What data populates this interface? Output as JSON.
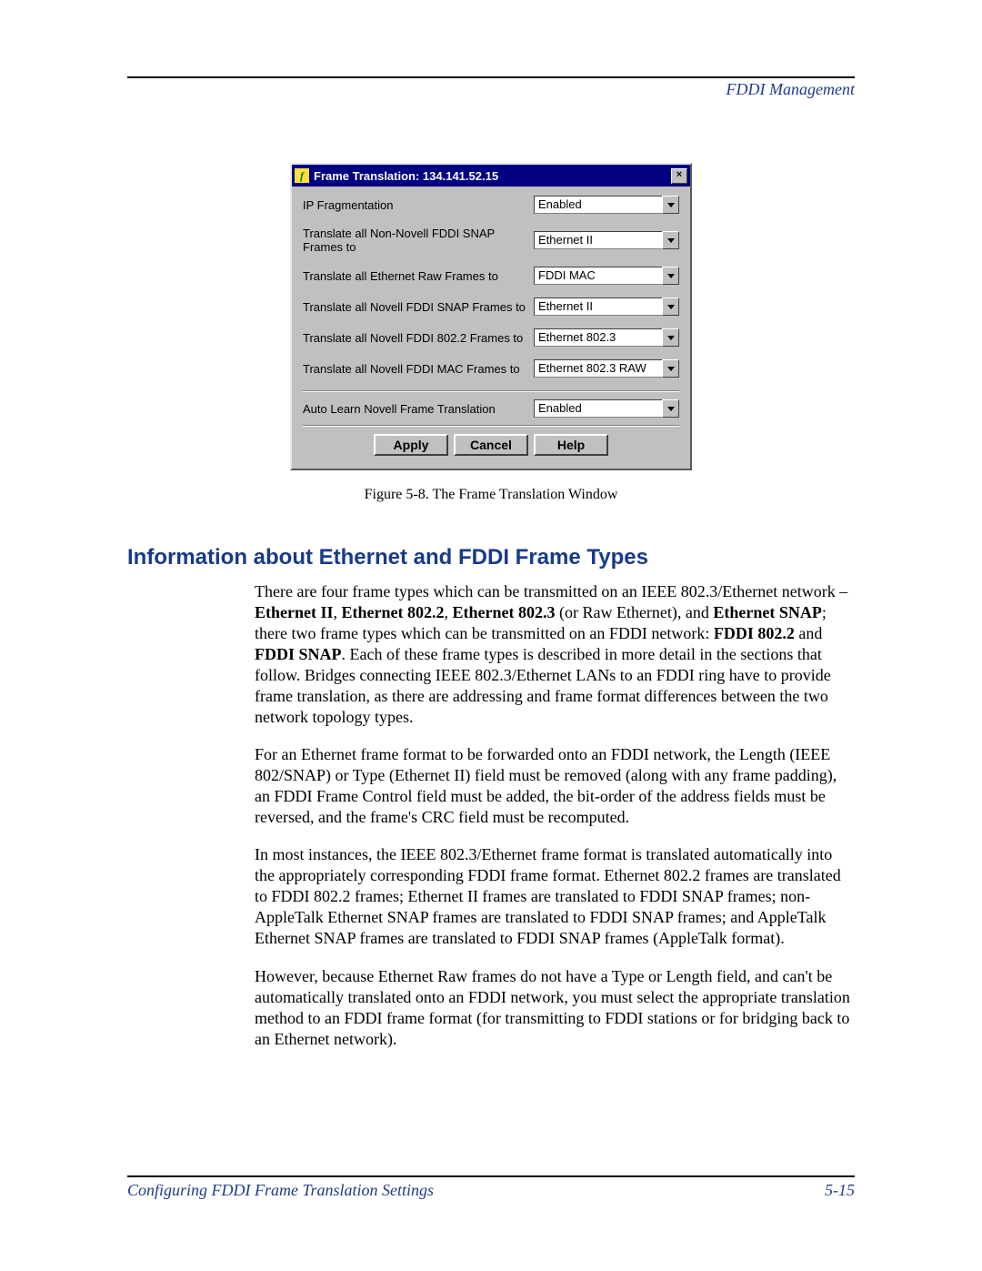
{
  "header": {
    "section_title": "FDDI Management"
  },
  "dialog": {
    "title": "Frame Translation: 134.141.52.15",
    "close_glyph": "×",
    "rows": [
      {
        "label": "IP Fragmentation",
        "value": "Enabled"
      },
      {
        "label": "Translate all Non-Novell FDDI SNAP Frames to",
        "value": "Ethernet II"
      },
      {
        "label": "Translate all Ethernet Raw Frames to",
        "value": "FDDI MAC"
      },
      {
        "label": "Translate all Novell FDDI SNAP Frames to",
        "value": "Ethernet II"
      },
      {
        "label": "Translate all Novell FDDI 802.2 Frames to",
        "value": "Ethernet 802.3"
      },
      {
        "label": "Translate all Novell FDDI MAC Frames to",
        "value": "Ethernet 802.3 RAW"
      },
      {
        "label": "Auto Learn Novell Frame Translation",
        "value": "Enabled"
      }
    ],
    "buttons": {
      "apply": "Apply",
      "cancel": "Cancel",
      "help": "Help"
    }
  },
  "figure_caption": "Figure 5-8. The Frame Translation Window",
  "heading": "Information about Ethernet and FDDI Frame Types",
  "paragraphs": {
    "p1_a": "There are four frame types which can be transmitted on an IEEE 802.3/Ethernet network – ",
    "p1_b1": "Ethernet II",
    "p1_c": ", ",
    "p1_b2": "Ethernet 802.2",
    "p1_d": ", ",
    "p1_b3": "Ethernet 802.3",
    "p1_e": " (or Raw Ethernet), and ",
    "p1_b4": "Ethernet SNAP",
    "p1_f": "; there two frame types which can be transmitted on an FDDI network: ",
    "p1_b5": "FDDI 802.2",
    "p1_g": " and ",
    "p1_b6": "FDDI SNAP",
    "p1_h": ". Each of these frame types is described in more detail in the sections that follow. Bridges connecting IEEE 802.3/Ethernet LANs to an FDDI ring have to provide frame translation, as there are addressing and frame format differences between the two network topology types.",
    "p2": "For an Ethernet frame format to be forwarded onto an FDDI network, the Length (IEEE 802/SNAP) or Type (Ethernet II) field must be removed (along with any frame padding), an FDDI Frame Control field must be added, the bit-order of the address fields must be reversed, and the frame's CRC field must be recomputed.",
    "p3": "In most instances, the IEEE 802.3/Ethernet frame format is translated automatically into the appropriately corresponding FDDI frame format. Ethernet 802.2 frames are translated to FDDI 802.2 frames; Ethernet II frames are translated to FDDI SNAP frames; non-AppleTalk Ethernet SNAP frames are translated to FDDI SNAP frames; and AppleTalk Ethernet SNAP frames are translated to FDDI SNAP frames (AppleTalk format).",
    "p4": "However, because Ethernet Raw frames do not have a Type or Length field, and can't be automatically translated onto an FDDI network, you must select the appropriate translation method to an FDDI frame format (for transmitting to FDDI stations or for bridging back to an Ethernet network)."
  },
  "footer": {
    "left": "Configuring FDDI Frame Translation Settings",
    "right": "5-15"
  }
}
